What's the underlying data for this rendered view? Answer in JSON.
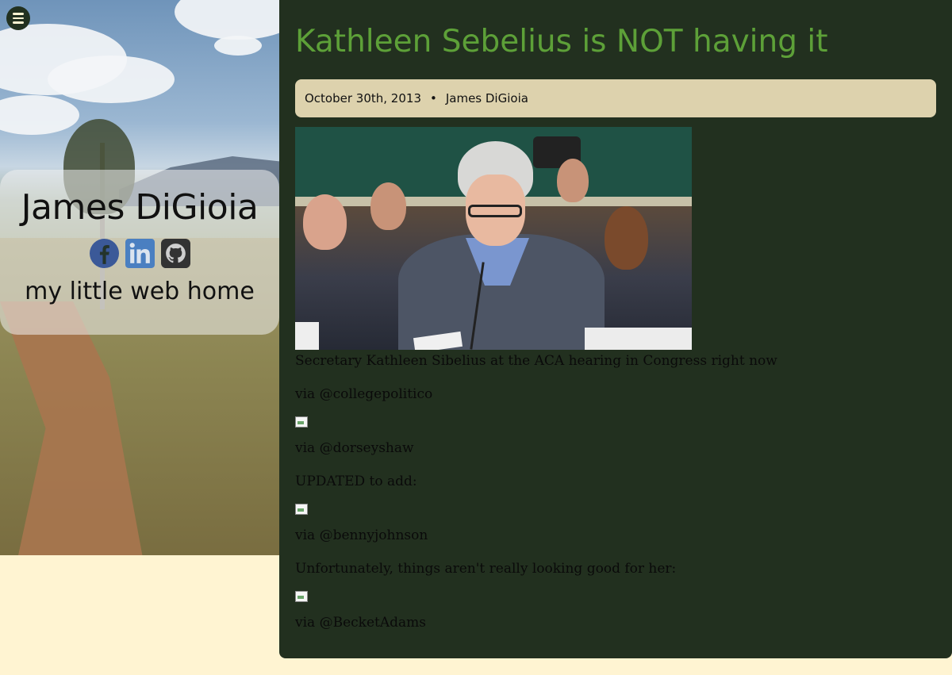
{
  "sidebar": {
    "menu_icon": "hamburger-menu-icon",
    "site_name": "James DiGioia",
    "tagline": "my little web home",
    "socials": [
      {
        "name": "facebook",
        "icon": "facebook-icon",
        "color": "#3b5998"
      },
      {
        "name": "linkedin",
        "icon": "linkedin-icon",
        "color": "#4a7fc1"
      },
      {
        "name": "github",
        "icon": "github-icon",
        "color": "#333333"
      }
    ]
  },
  "post": {
    "title": "Kathleen Sebelius is NOT having it",
    "date": "October 30th, 2013",
    "separator": "•",
    "author": "James DiGioia",
    "paragraphs": {
      "caption": "Secretary Kathleen Sibelius at the ACA hearing in Congress right now",
      "via1": "via @collegepolitico",
      "via2": "via @dorseyshaw",
      "updated": "UPDATED to add:",
      "via3": "via @bennyjohnson",
      "unfortunately": "Unfortunately, things aren't really looking good for her:",
      "via4": "via @BecketAdams"
    }
  },
  "colors": {
    "page_background": "#fff4d2",
    "panel_background": "#22301f",
    "title_green": "#5da038",
    "meta_background": "#ddd2ad"
  }
}
